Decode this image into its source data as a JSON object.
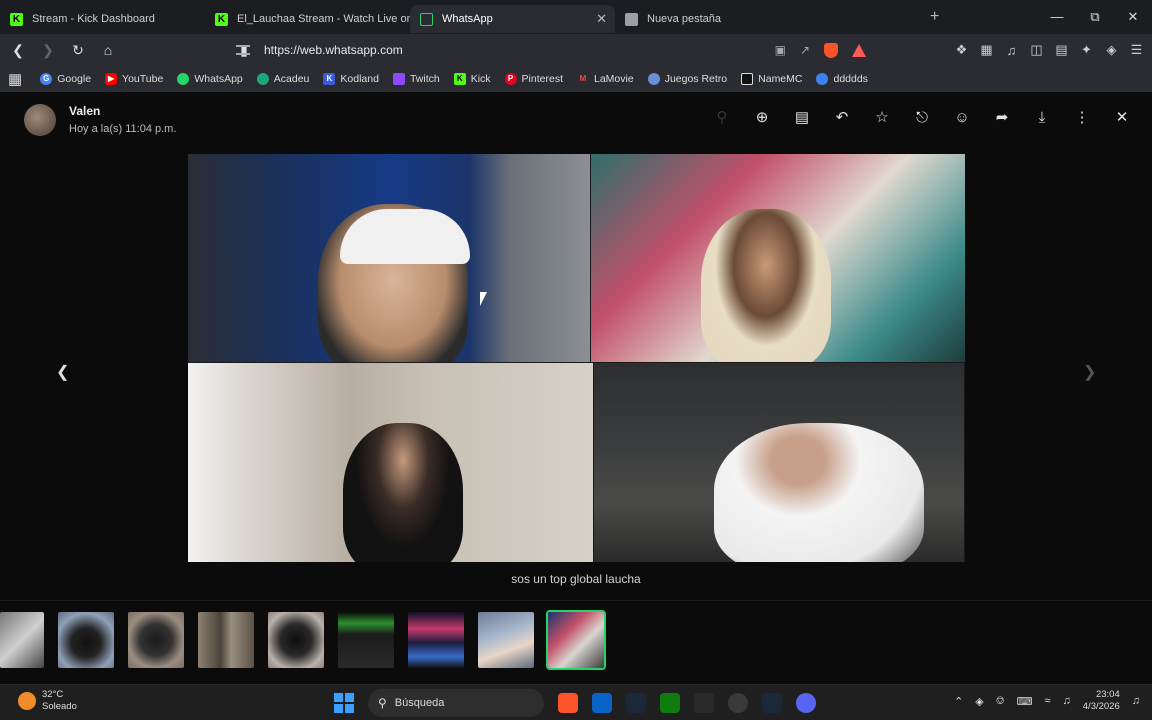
{
  "browser": {
    "tabs": [
      {
        "title": "Stream - Kick Dashboard",
        "icon": "kick-icon",
        "active": false
      },
      {
        "title": "El_Lauchaa Stream - Watch Live on K",
        "icon": "kick-icon",
        "active": false
      },
      {
        "title": "WhatsApp",
        "icon": "whatsapp-icon",
        "active": true,
        "close": "✕"
      },
      {
        "title": "Nueva pestaña",
        "icon": "brave-shield-icon",
        "active": false
      }
    ],
    "new_tab": "+",
    "url": "https://web.whatsapp.com",
    "bookmarks": [
      "Google",
      "YouTube",
      "WhatsApp",
      "Acadeu",
      "Kodland",
      "Twitch",
      "Kick",
      "Pinterest",
      "LaMovie",
      "Juegos Retro",
      "NameMC",
      "ddddds"
    ],
    "bookmark_colors": [
      "#4285f4",
      "#ff0000",
      "#25d366",
      "#1fa67a",
      "#3b5bdb",
      "#9146ff",
      "#53fc18",
      "#e60023",
      "#c0392b",
      "#6b8fd6",
      "#111111",
      "#3b82f6"
    ]
  },
  "viewer": {
    "sender": "Valen",
    "timestamp": "Hoy a la(s) 11:04 p.m.",
    "caption": "sos un top global laucha",
    "actions": [
      "zoom-out-icon",
      "zoom-in-icon",
      "caption-icon",
      "reply-icon",
      "star-icon",
      "pin-icon",
      "react-icon",
      "forward-icon",
      "download-icon",
      "more-icon",
      "close-icon"
    ],
    "thumbnail_count": 9,
    "selected_thumbnail": 9
  },
  "taskbar": {
    "temperature": "32°C",
    "weather": "Soleado",
    "search_placeholder": "Búsqueda",
    "time": "23:04",
    "date": "4/3/2026"
  },
  "colors": {
    "accent": "#25d366",
    "background": "#0b0b0b"
  }
}
